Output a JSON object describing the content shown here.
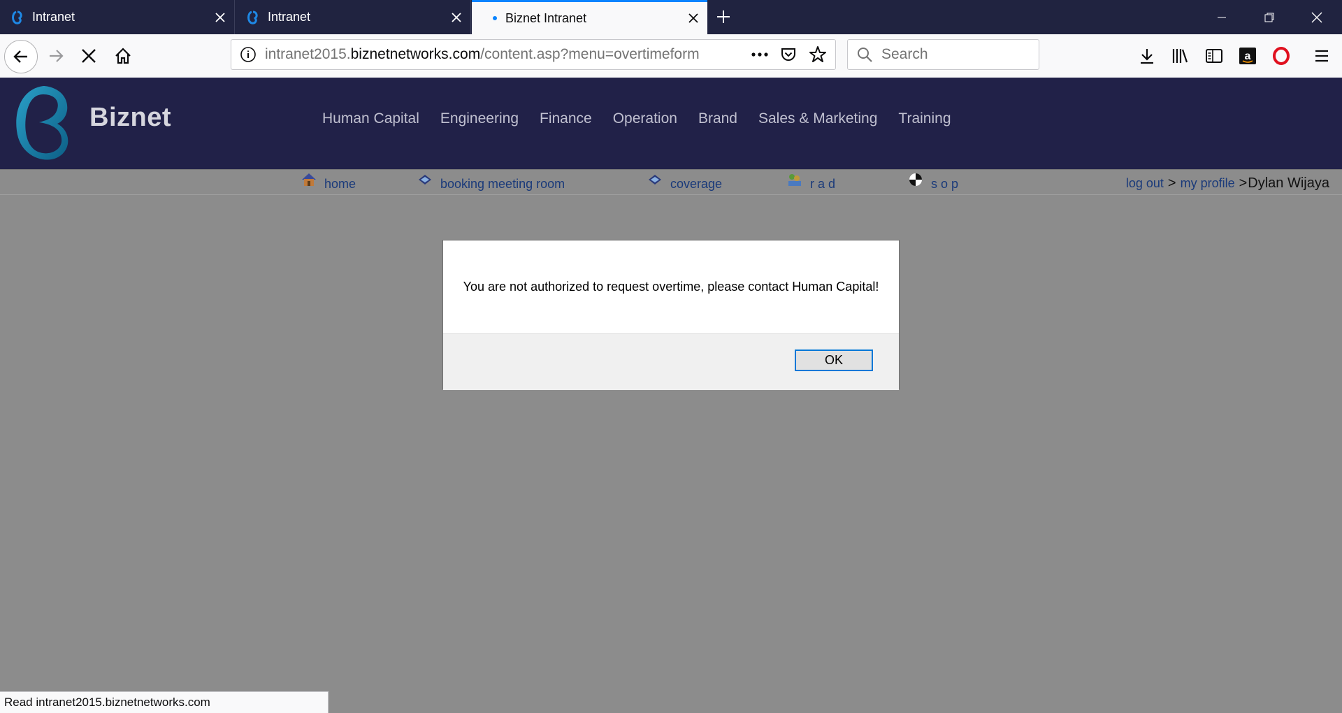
{
  "tabs": [
    {
      "title": "Intranet"
    },
    {
      "title": "Intranet"
    },
    {
      "title": "Biznet Intranet"
    }
  ],
  "urlbar": {
    "prefix": "intranet2015.",
    "host": "biznetnetworks.com",
    "path": "/content.asp?menu=overtimeform"
  },
  "search": {
    "placeholder": "Search"
  },
  "site": {
    "brand": "Biznet",
    "menu": [
      "Human Capital",
      "Engineering",
      "Finance",
      "Operation",
      "Brand",
      "Sales & Marketing",
      "Training"
    ],
    "subnav": [
      {
        "label": "home",
        "icon": "house-icon"
      },
      {
        "label": "booking meeting room",
        "icon": "booking-icon"
      },
      {
        "label": "coverage",
        "icon": "coverage-icon"
      },
      {
        "label": "r a d",
        "icon": "rad-icon"
      },
      {
        "label": "s o p",
        "icon": "sop-icon"
      }
    ],
    "user": {
      "logout": "log out",
      "sep1": ">",
      "profile": "my profile",
      "sep2": ">",
      "name": "Dylan Wijaya"
    }
  },
  "dialog": {
    "message": "You are not authorized to request overtime, please contact Human Capital!",
    "ok_label": "OK"
  },
  "status": {
    "text": "Read intranet2015.biznetnetworks.com"
  },
  "colors": {
    "tabstrip": "#202340",
    "site_header": "#212148",
    "overlay": "#8c8c8c",
    "accent": "#0a84ff"
  }
}
